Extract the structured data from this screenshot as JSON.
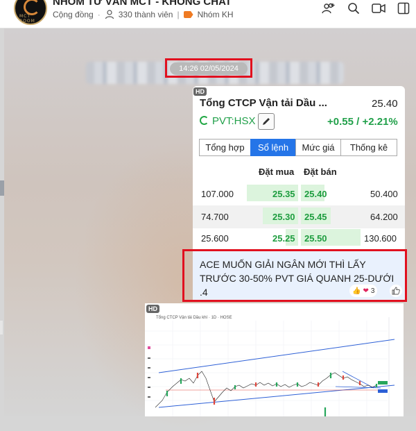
{
  "header": {
    "title": "NHÓM TƯ VẤN MCT - KHÔNG CHAT",
    "category": "Cộng đồng",
    "members": "330 thành viên",
    "group_tag": "Nhóm KH",
    "avatar_logo_text": "MCT ROOM"
  },
  "chat": {
    "timestamp": "14:26 02/05/2024"
  },
  "stock_card": {
    "hd_badge": "HD",
    "name": "Tổng CTCP Vận tải Dầu ...",
    "price": "25.40",
    "ticker": "PVT:HSX",
    "change": "+0.55 / +2.21%",
    "tabs": [
      "Tổng hợp",
      "Sổ lệnh",
      "Mức giá",
      "Thống kê"
    ],
    "active_tab": "Sổ lệnh",
    "col_bid": "Đặt mua",
    "col_ask": "Đặt bán",
    "orderbook": [
      {
        "bid_vol": "107.000",
        "bid": "25.35",
        "ask": "25.40",
        "ask_vol": "50.400",
        "bid_fill": 0.55,
        "ask_fill": 0.3
      },
      {
        "bid_vol": "74.700",
        "bid": "25.30",
        "ask": "25.45",
        "ask_vol": "64.200",
        "bid_fill": 0.38,
        "ask_fill": 0.38
      },
      {
        "bid_vol": "25.600",
        "bid": "25.25",
        "ask": "25.50",
        "ask_vol": "130.600",
        "bid_fill": 0.13,
        "ask_fill": 0.76
      }
    ],
    "up_color": "#1e9d3f"
  },
  "message": {
    "text": "ACE MUỐN GIẢI NGÂN MỚI THÌ LẤY TRƯỚC 30-50% PVT GIÁ QUANH 25-DƯỚI .4",
    "reaction_count": "3"
  },
  "chart_preview": {
    "hd_badge": "HD",
    "title": "Tổng CTCP Vận tải Dầu khí · 1D · HOSE"
  },
  "colors": {
    "highlight_box": "#e1101f",
    "accent": "#2575e8",
    "bid_fill": "#dcf4dd"
  }
}
